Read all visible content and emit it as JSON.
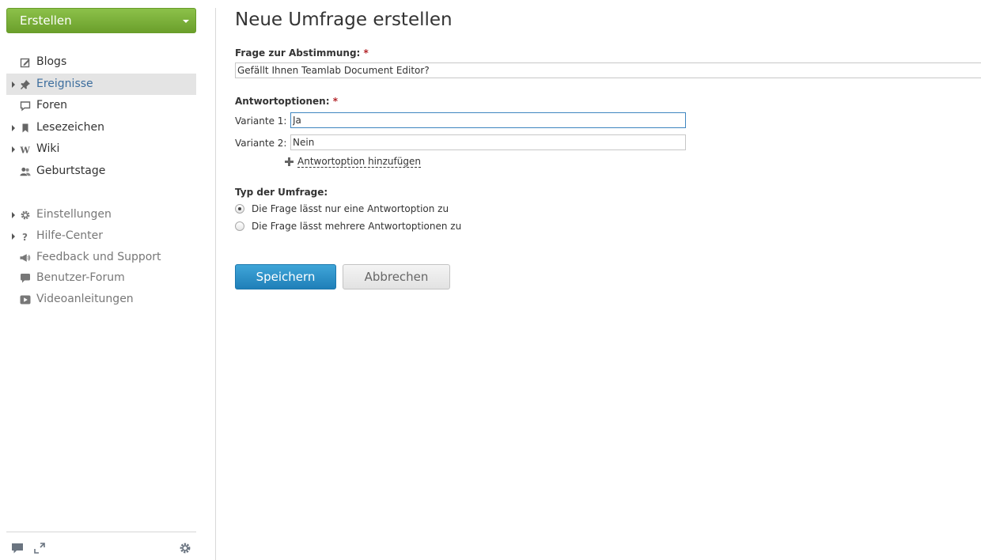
{
  "sidebar": {
    "create_label": "Erstellen",
    "items": [
      {
        "label": "Blogs",
        "icon": "blog-edit-icon",
        "expandable": false,
        "active": false
      },
      {
        "label": "Ereignisse",
        "icon": "pin-icon",
        "expandable": true,
        "active": true
      },
      {
        "label": "Foren",
        "icon": "forum-icon",
        "expandable": false,
        "active": false
      },
      {
        "label": "Lesezeichen",
        "icon": "bookmark-icon",
        "expandable": true,
        "active": false
      },
      {
        "label": "Wiki",
        "icon": "wiki-icon",
        "expandable": true,
        "active": false
      },
      {
        "label": "Geburtstage",
        "icon": "people-icon",
        "expandable": false,
        "active": false
      }
    ],
    "secondary_items": [
      {
        "label": "Einstellungen",
        "icon": "gear-icon",
        "expandable": true
      },
      {
        "label": "Hilfe-Center",
        "icon": "question-icon",
        "expandable": true
      },
      {
        "label": "Feedback und Support",
        "icon": "megaphone-icon",
        "expandable": false
      },
      {
        "label": "Benutzer-Forum",
        "icon": "speech-bubble-icon",
        "expandable": false
      },
      {
        "label": "Videoanleitungen",
        "icon": "video-play-icon",
        "expandable": false
      }
    ],
    "footer_icons": [
      "chat-icon",
      "expand-icon",
      "settings-gear-icon"
    ]
  },
  "main": {
    "title": "Neue Umfrage erstellen",
    "question_label": "Frage zur Abstimmung:",
    "question_value": "Gefällt Ihnen Teamlab Document Editor?",
    "required_mark": "*",
    "options_label": "Antwortoptionen:",
    "variants": [
      {
        "label": "Variante 1:",
        "value": "Ja"
      },
      {
        "label": "Variante 2:",
        "value": "Nein"
      }
    ],
    "add_option_label": "Antwortoption hinzufügen",
    "type_label": "Typ der Umfrage:",
    "type_options": [
      {
        "label": "Die Frage lässt nur eine Antwortoption zu",
        "checked": true
      },
      {
        "label": "Die Frage lässt mehrere Antwortoptionen zu",
        "checked": false
      }
    ],
    "save_label": "Speichern",
    "cancel_label": "Abbrechen"
  },
  "colors": {
    "create_button": "#7cb342",
    "save_button": "#2b8fc8",
    "active_link": "#3d6e9e",
    "required": "#b3252a"
  }
}
